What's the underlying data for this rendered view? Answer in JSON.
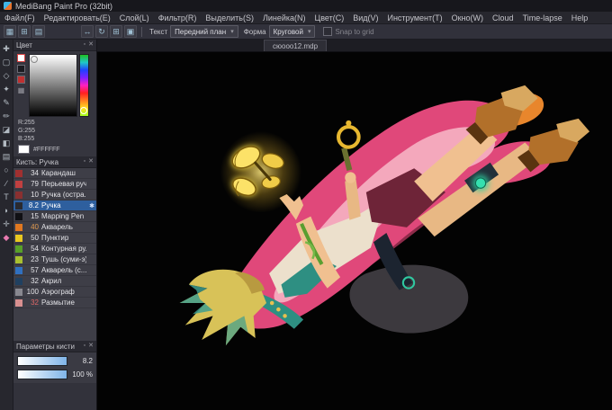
{
  "window": {
    "title": "MediBang Paint Pro (32bit)"
  },
  "menu_bar": {
    "items": [
      "Файл(F)",
      "Редактировать(E)",
      "Слой(L)",
      "Фильтр(R)",
      "Выделить(S)",
      "Линейка(N)",
      "Цвет(C)",
      "Вид(V)",
      "Инструмент(T)",
      "Окно(W)",
      "Cloud",
      "Time-lapse",
      "Help"
    ]
  },
  "toolbar": {
    "left_icons": [
      {
        "dn": "dock-color-icon",
        "glyph": "▦"
      },
      {
        "dn": "dock-brush-icon",
        "glyph": "⊞"
      },
      {
        "dn": "dock-layer-icon",
        "glyph": "▤"
      }
    ],
    "mid_icons": [
      {
        "dn": "transform-icon",
        "glyph": "↔"
      },
      {
        "dn": "rotate-canvas-icon",
        "glyph": "↻"
      },
      {
        "dn": "grid-toggle-icon",
        "glyph": "⊞"
      },
      {
        "dn": "material-panel-icon",
        "glyph": "▣"
      }
    ],
    "text_label": "Текст",
    "foreground_value": "Передний план",
    "shape_label": "Форма",
    "shape_value": "Круговой",
    "snap_label": "Snap to grid"
  },
  "tools": [
    {
      "dn": "move-tool",
      "glyph": "✚"
    },
    {
      "dn": "marquee-select-tool",
      "glyph": "▢"
    },
    {
      "dn": "lasso-tool",
      "glyph": "◇"
    },
    {
      "dn": "magic-wand-tool",
      "glyph": "✦"
    },
    {
      "dn": "select-pen-tool",
      "glyph": "✎"
    },
    {
      "dn": "brush-tool",
      "glyph": "✏"
    },
    {
      "dn": "eraser-tool",
      "glyph": "◪"
    },
    {
      "dn": "bucket-tool",
      "glyph": "◧"
    },
    {
      "dn": "gradient-tool",
      "glyph": "▤"
    },
    {
      "dn": "shape-tool",
      "glyph": "○"
    },
    {
      "dn": "divide-tool",
      "glyph": "∕"
    },
    {
      "dn": "text-tool",
      "glyph": "T"
    },
    {
      "dn": "eyedropper-tool",
      "glyph": "◗"
    },
    {
      "dn": "hand-tool",
      "glyph": "✛"
    },
    {
      "dn": "symmetry-tool",
      "glyph": "◆",
      "color": "#e87ab0"
    }
  ],
  "color_panel": {
    "title": "Цвет",
    "r": "R:255",
    "g": "G:255",
    "b": "B:255",
    "hex": "#FFFFFF",
    "current_color": "#FFFFFF"
  },
  "brush_panel": {
    "title": "Кисть: Ручка",
    "brushes": [
      {
        "size": "34",
        "name": "Карандаш",
        "swatch": "#a03030"
      },
      {
        "size": "79",
        "name": "Перьевая руч...",
        "swatch": "#c04040"
      },
      {
        "size": "10",
        "name": "Ручка (остра...",
        "swatch": "#8a3030"
      },
      {
        "size": "8.2",
        "name": "Ручка",
        "swatch": "#2a2a30",
        "selected": true,
        "gear": true
      },
      {
        "size": "15",
        "name": "Mapping Pen",
        "swatch": "#101014"
      },
      {
        "size": "40",
        "name": "Акварель",
        "swatch": "#e07820",
        "num_color": "#e09a50"
      },
      {
        "size": "50",
        "name": "Пунктир",
        "swatch": "#e8c820"
      },
      {
        "size": "54",
        "name": "Контурная ру...",
        "swatch": "#58a028"
      },
      {
        "size": "23",
        "name": "Тушь (суми-э)",
        "swatch": "#a8c030"
      },
      {
        "size": "57",
        "name": "Акварель (с...",
        "swatch": "#3070c0"
      },
      {
        "size": "32",
        "name": "Акрил",
        "swatch": "#204060"
      },
      {
        "size": "100",
        "name": "Аэрограф",
        "swatch": "#888890"
      },
      {
        "size": "32",
        "name": "Размытие",
        "swatch": "#d89090",
        "num_color": "#e06868"
      }
    ]
  },
  "params_panel": {
    "title": "Параметры кисти",
    "sliders": [
      {
        "dn": "brush-size-slider",
        "value": "8.2"
      },
      {
        "dn": "brush-opacity-slider",
        "value": "100 %"
      }
    ]
  },
  "canvas": {
    "tab": "сюооо12.mdp"
  },
  "colors": {
    "selection_blue": "#2e5f9e",
    "panel_bg": "#35353e",
    "cape_pink": "#e0487a",
    "butterfly_gold": "#f6d83c"
  }
}
